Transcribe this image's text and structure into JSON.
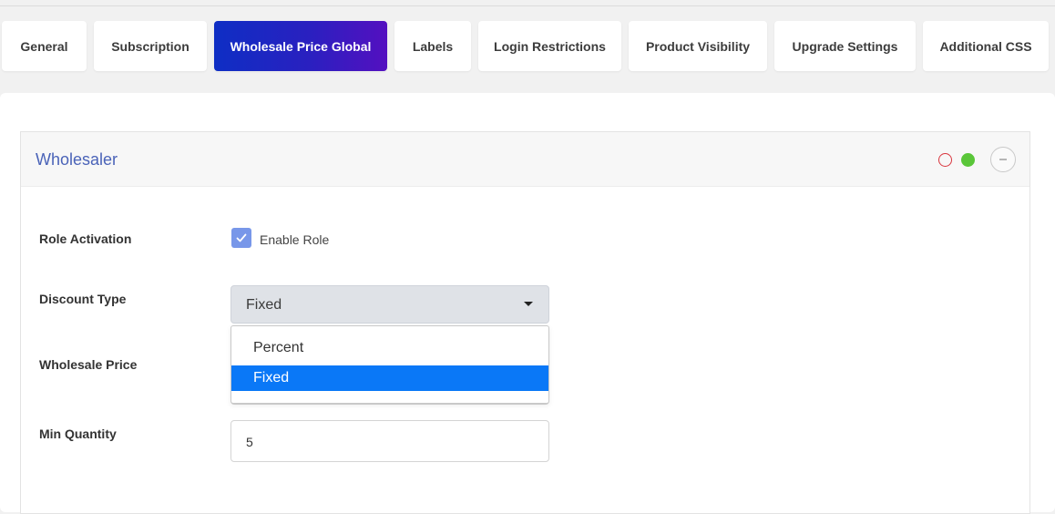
{
  "tabs": [
    {
      "label": "General",
      "active": false
    },
    {
      "label": "Subscription",
      "active": false
    },
    {
      "label": "Wholesale Price Global",
      "active": true
    },
    {
      "label": "Labels",
      "active": false
    },
    {
      "label": "Login Restrictions",
      "active": false
    },
    {
      "label": "Product Visibility",
      "active": false
    },
    {
      "label": "Upgrade Settings",
      "active": false
    },
    {
      "label": "Additional CSS",
      "active": false
    }
  ],
  "colors": {
    "active_tab_start": "#0e2ec4",
    "active_tab_end": "#5410c0",
    "panel_title": "#4a63b8",
    "status_red": "#d9363e",
    "status_green": "#5ac639",
    "checkbox": "#7897e9",
    "option_highlight": "#0a78f7"
  },
  "panel": {
    "title": "Wholesaler",
    "icons": [
      "status-red-outline-icon",
      "status-green-dot-icon",
      "collapse-minus-icon"
    ]
  },
  "form": {
    "role_activation": {
      "label": "Role Activation",
      "checkbox_label": "Enable Role",
      "checked": true
    },
    "discount_type": {
      "label": "Discount Type",
      "selected": "Fixed",
      "options": [
        "Percent",
        "Fixed"
      ],
      "highlighted_option": "Fixed"
    },
    "wholesale_price": {
      "label": "Wholesale Price",
      "value": ""
    },
    "min_quantity": {
      "label": "Min Quantity",
      "value": "5"
    }
  }
}
